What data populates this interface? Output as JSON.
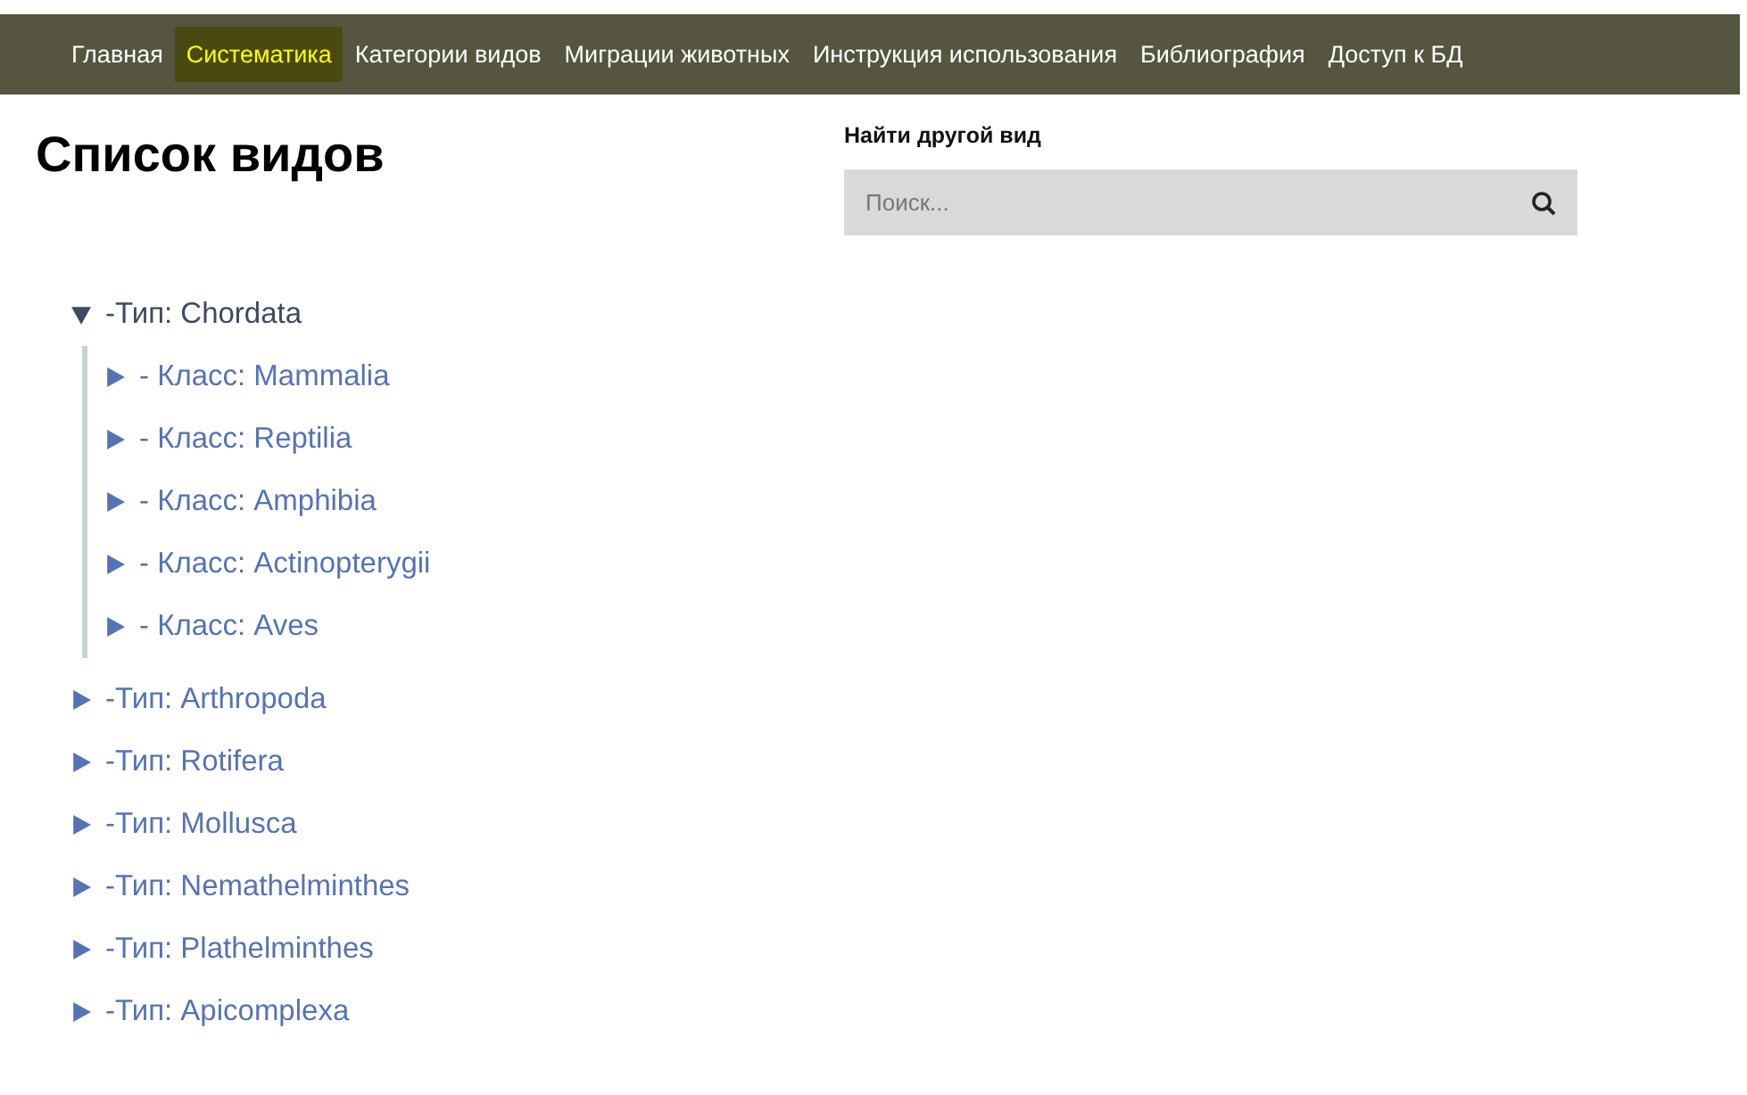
{
  "nav": [
    {
      "label": "Главная",
      "selected": false
    },
    {
      "label": "Систематика",
      "selected": true
    },
    {
      "label": "Категории видов",
      "selected": false
    },
    {
      "label": "Миграции животных",
      "selected": false
    },
    {
      "label": "Инструкция использования",
      "selected": false
    },
    {
      "label": "Библиография",
      "selected": false
    },
    {
      "label": "Доступ к БД",
      "selected": false
    }
  ],
  "title": "Список видов",
  "search": {
    "label": "Найти другой вид",
    "placeholder": "Поиск..."
  },
  "tree": [
    {
      "label": "-Тип: Chordata",
      "expanded": true,
      "children": [
        {
          "label": "- Класс: Mammalia",
          "expanded": false
        },
        {
          "label": "- Класс: Reptilia",
          "expanded": false
        },
        {
          "label": "- Класс: Amphibia",
          "expanded": false
        },
        {
          "label": "- Класс: Actinopterygii",
          "expanded": false
        },
        {
          "label": "- Класс: Aves",
          "expanded": false
        }
      ]
    },
    {
      "label": "-Тип: Arthropoda",
      "expanded": false
    },
    {
      "label": "-Тип: Rotifera",
      "expanded": false
    },
    {
      "label": "-Тип: Mollusca",
      "expanded": false
    },
    {
      "label": "-Тип: Nemathelminthes",
      "expanded": false
    },
    {
      "label": "-Тип: Plathelminthes",
      "expanded": false
    },
    {
      "label": "-Тип: Apicomplexa",
      "expanded": false
    }
  ]
}
